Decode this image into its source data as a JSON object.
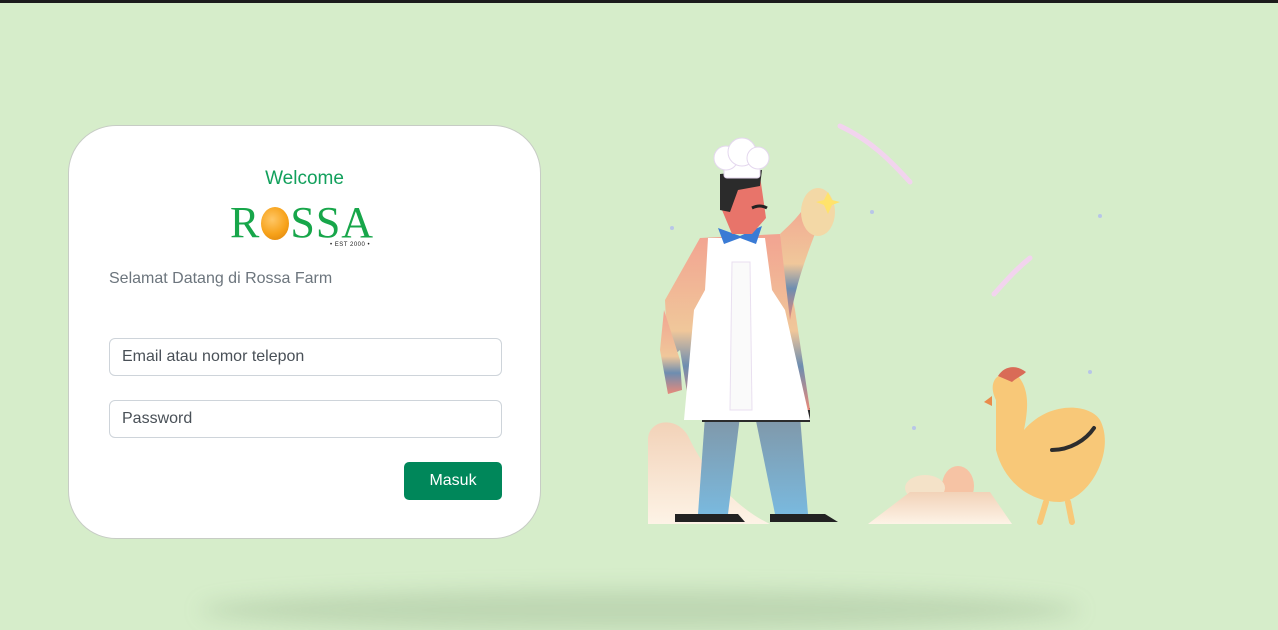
{
  "login": {
    "welcome": "Welcome",
    "logo": {
      "text": "ROSSA",
      "tagline": "• EST 2000 •"
    },
    "subtitle": "Selamat Datang di Rossa Farm",
    "email_placeholder": "Email atau nomor telepon",
    "password_placeholder": "Password",
    "submit_label": "Masuk"
  },
  "colors": {
    "background": "#d6edca",
    "brand_green": "#12a05c",
    "button_green": "#00875a",
    "logo_egg": "#f7a21a"
  },
  "illustration": {
    "icons": [
      "chef-icon",
      "chicken-icon",
      "egg-icon"
    ]
  }
}
